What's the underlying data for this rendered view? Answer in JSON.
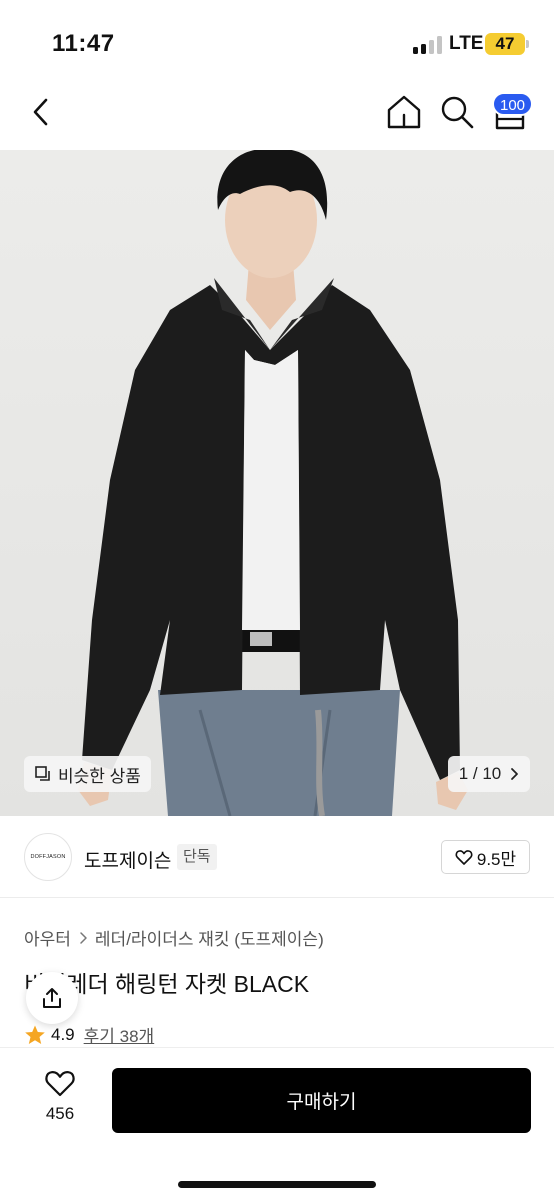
{
  "status_bar": {
    "time": "11:47",
    "network": "LTE",
    "battery": "47"
  },
  "nav": {
    "back_icon": "chevron-left-icon",
    "home_icon": "home-icon",
    "search_icon": "search-icon",
    "cart_icon": "cart-icon",
    "cart_badge": "100",
    "badge_color": "#2a5bf0"
  },
  "product_image": {
    "similar_label": "비슷한 상품",
    "pager_text": "1 / 10"
  },
  "brand": {
    "logo_text": "DOFFJASON",
    "name": "도프제이슨",
    "badge": "단독",
    "like_count": "9.5만"
  },
  "breadcrumb": {
    "items": [
      "아우터",
      "레더/라이더스 재킷 (도프제이슨)"
    ]
  },
  "product": {
    "title": "비건레더 해링턴 자켓 BLACK",
    "rating": "4.9",
    "review_label": "후기 38개",
    "star_color": "#f5a623"
  },
  "bottom_bar": {
    "wish_count": "456",
    "buy_label": "구매하기"
  }
}
